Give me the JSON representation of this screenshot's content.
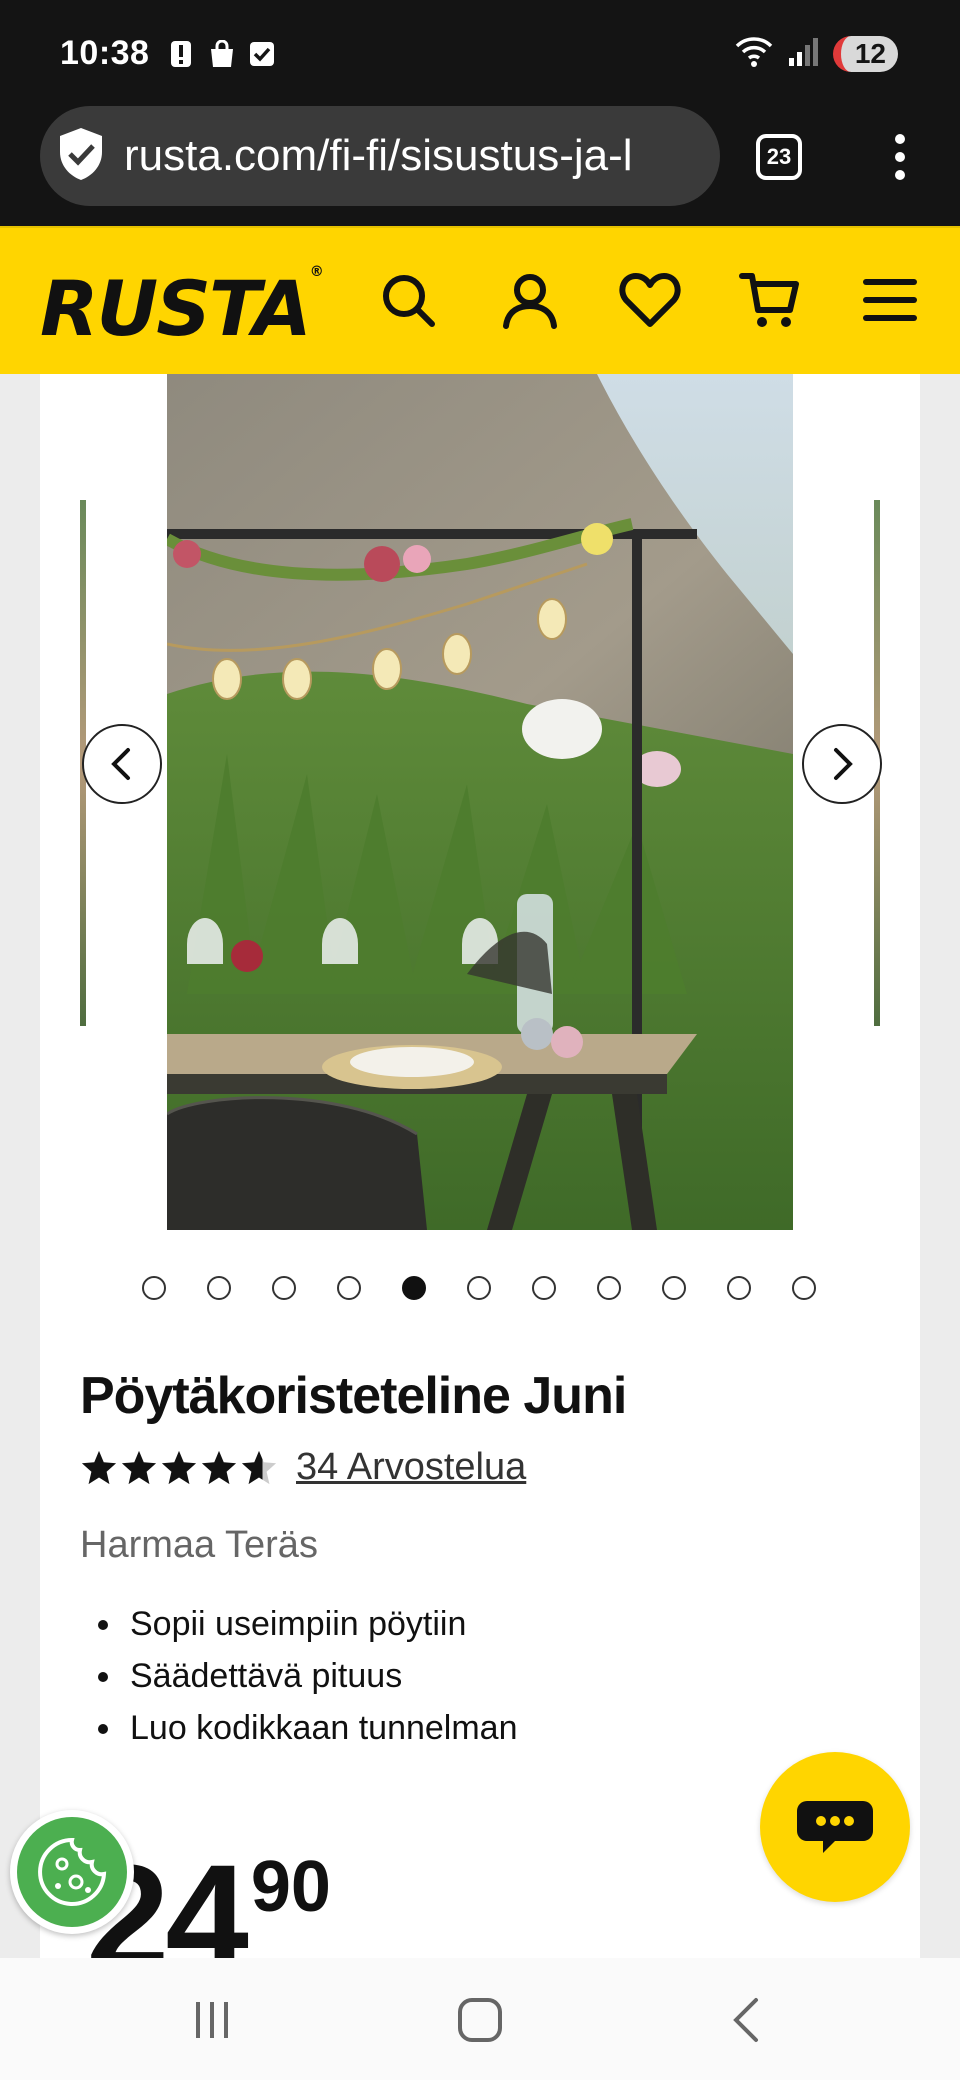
{
  "status_bar": {
    "time": "10:38",
    "network_badge": "12",
    "icons": [
      "alert-icon",
      "bag-icon",
      "check-icon",
      "wifi-icon",
      "signal-icon"
    ]
  },
  "browser": {
    "url": "rusta.com/fi-fi/sisustus-ja-l",
    "tab_count": "23"
  },
  "header": {
    "logo": "RUSTA",
    "logo_mark": "®",
    "icons": [
      "search-icon",
      "account-icon",
      "wishlist-icon",
      "cart-icon",
      "menu-icon"
    ]
  },
  "carousel": {
    "image_count": 11,
    "active_index": 4
  },
  "product": {
    "title": "Pöytäkoristeteline Juni",
    "rating": 4.6,
    "rating_max": 5,
    "reviews_label": "34 Arvostelua",
    "variant": "Harmaa Teräs",
    "features": [
      "Sopii useimpiin pöytiin",
      "Säädettävä pituus",
      "Luo kodikkaan tunnelman"
    ],
    "price_int": "24",
    "price_dec": "90"
  },
  "colors": {
    "brand_yellow": "#ffd500",
    "cookie_green": "#4caf50",
    "text_dark": "#111111"
  }
}
